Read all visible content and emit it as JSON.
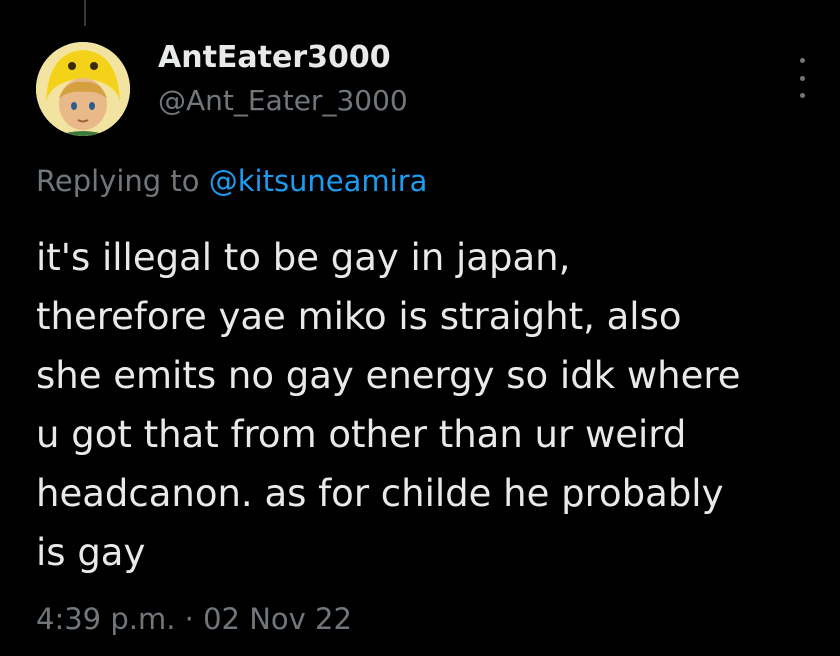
{
  "tweet": {
    "display_name": "AntEater3000",
    "handle": "@Ant_Eater_3000",
    "avatar_icon": "cartoon-character-in-yellow-hood-icon",
    "reply_prefix": "Replying to",
    "reply_mention": "@kitsuneamira",
    "body": "it's illegal to be gay in japan,\ntherefore yae miko is straight, also\nshe emits no gay energy so idk where\nu got that from other than ur weird\nheadcanon. as for childe he probably\nis gay",
    "timestamp": "4:39 p.m. · 02 Nov 22"
  },
  "colors": {
    "background": "#000000",
    "primary_text": "#e7e9ea",
    "secondary_text": "#71767b",
    "link": "#1d9bf0"
  }
}
